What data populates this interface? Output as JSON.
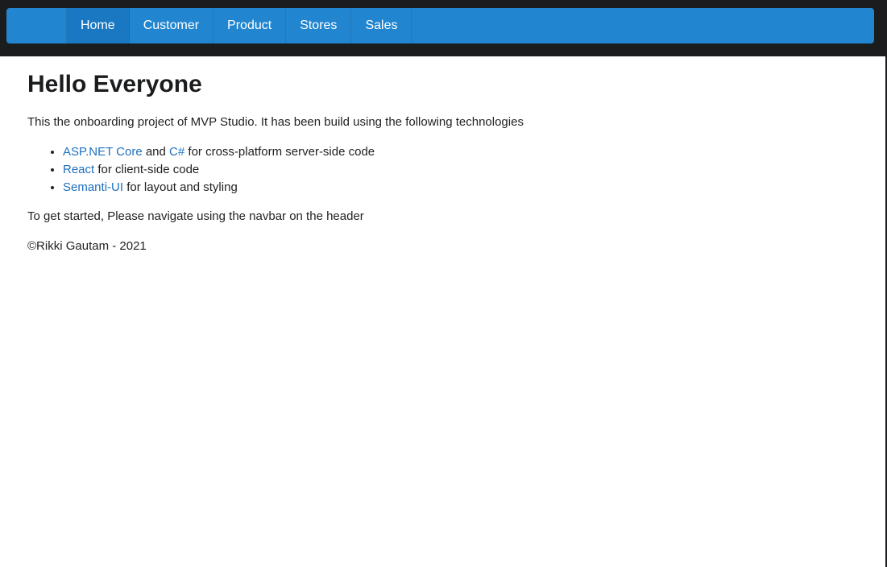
{
  "nav": {
    "items": [
      {
        "label": "Home"
      },
      {
        "label": "Customer"
      },
      {
        "label": "Product"
      },
      {
        "label": "Stores"
      },
      {
        "label": "Sales"
      }
    ],
    "active": "Home"
  },
  "main": {
    "heading": "Hello Everyone",
    "intro": "This the onboarding project of MVP Studio. It has been build using the following technologies",
    "technologies": [
      {
        "links": [
          "ASP.NET Core",
          "C#"
        ],
        "joiner": "and",
        "text": "for cross-platform server-side code"
      },
      {
        "links": [
          "React"
        ],
        "text": "for client-side code"
      },
      {
        "links": [
          "Semanti-UI"
        ],
        "text": "for layout and styling"
      }
    ],
    "getting_started": "To get started, Please navigate using the navbar on the header",
    "copyright": "©Rikki Gautam - 2021"
  },
  "colors": {
    "navbar_bg": "#1b1c1d",
    "menu_bg": "#2185d0",
    "menu_active_bg": "#1a78c2",
    "link": "#1e70bf"
  }
}
